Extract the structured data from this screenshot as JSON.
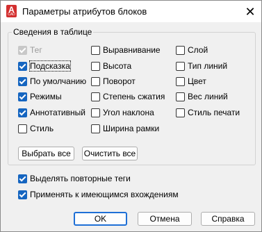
{
  "window": {
    "title": "Параметры атрибутов блоков",
    "icon_letter": "A",
    "icon_sub": "CAD",
    "close_glyph": "✕"
  },
  "group": {
    "legend": "Сведения в таблице",
    "columns": [
      [
        {
          "label": "Тег",
          "checked": true,
          "disabled": true
        },
        {
          "label": "Подсказка",
          "checked": true,
          "disabled": false,
          "focused": true
        },
        {
          "label": "По умолчанию",
          "checked": true,
          "disabled": false
        },
        {
          "label": "Режимы",
          "checked": true,
          "disabled": false
        },
        {
          "label": "Аннотативный",
          "checked": true,
          "disabled": false
        },
        {
          "label": "Стиль",
          "checked": false,
          "disabled": false
        }
      ],
      [
        {
          "label": "Выравнивание",
          "checked": false,
          "disabled": false
        },
        {
          "label": "Высота",
          "checked": false,
          "disabled": false
        },
        {
          "label": "Поворот",
          "checked": false,
          "disabled": false
        },
        {
          "label": "Степень сжатия",
          "checked": false,
          "disabled": false
        },
        {
          "label": "Угол наклона",
          "checked": false,
          "disabled": false
        },
        {
          "label": "Ширина рамки",
          "checked": false,
          "disabled": false
        }
      ],
      [
        {
          "label": "Слой",
          "checked": false,
          "disabled": false
        },
        {
          "label": "Тип линий",
          "checked": false,
          "disabled": false
        },
        {
          "label": "Цвет",
          "checked": false,
          "disabled": false
        },
        {
          "label": "Вес линий",
          "checked": false,
          "disabled": false
        },
        {
          "label": "Стиль печати",
          "checked": false,
          "disabled": false
        }
      ]
    ],
    "select_all_label": "Выбрать все",
    "clear_all_label": "Очистить все"
  },
  "options": {
    "highlight_duplicate_tags": {
      "label": "Выделять повторные теги",
      "checked": true
    },
    "apply_to_existing": {
      "label": "Применять к имеющимся вхождениям",
      "checked": true
    }
  },
  "buttons": {
    "ok": "OK",
    "cancel": "Отмена",
    "help": "Справка"
  },
  "colors": {
    "accent": "#1565c0",
    "icon_red": "#d32f2f",
    "disabled_gray": "#c8c8c8"
  }
}
